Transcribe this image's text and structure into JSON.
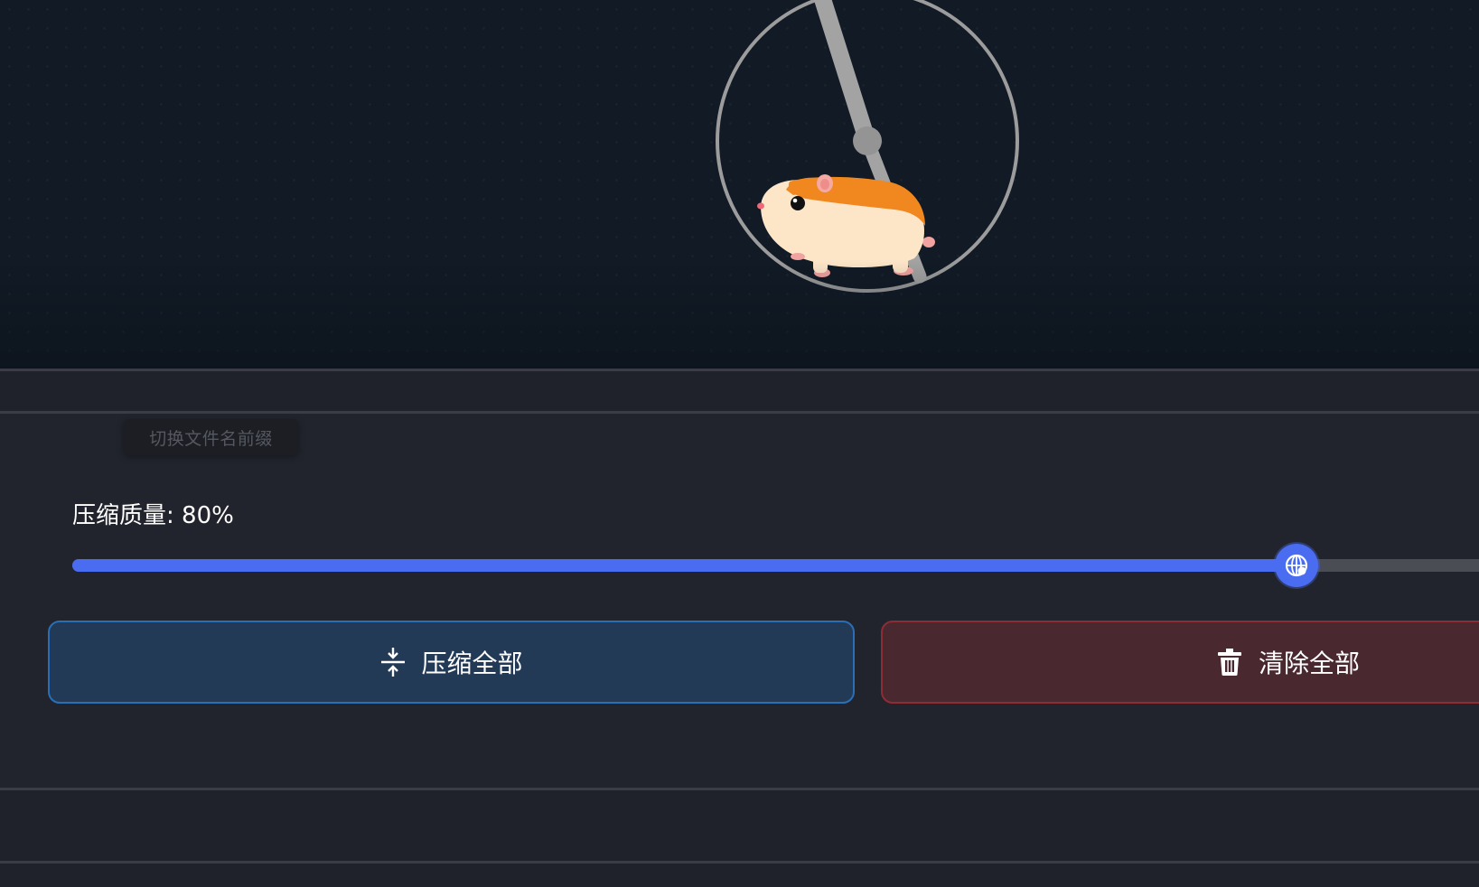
{
  "tooltip": {
    "text": "切换文件名前缀"
  },
  "quality": {
    "label": "压缩质量",
    "separator": ": ",
    "value_text": "80%",
    "slider_fraction": 0.87
  },
  "buttons": {
    "compress_all": {
      "label": "压缩全部",
      "icon": "compress-arrows-icon"
    },
    "clear_all": {
      "label": "清除全部",
      "icon": "trash-icon"
    }
  },
  "illustration": {
    "subject": "hamster-running-in-wheel",
    "icon": "hamster-wheel-icon"
  },
  "colors": {
    "accent": "#4a6cf0",
    "hero_background": "#111a25",
    "panel_background": "#21242d",
    "compress_button_bg": "#233a57",
    "compress_button_border": "#2a6fb6",
    "clear_button_bg": "#4a2830",
    "clear_button_border": "#8e2c36",
    "hamster_orange": "#f0881f",
    "hamster_cream": "#fde5c8"
  }
}
